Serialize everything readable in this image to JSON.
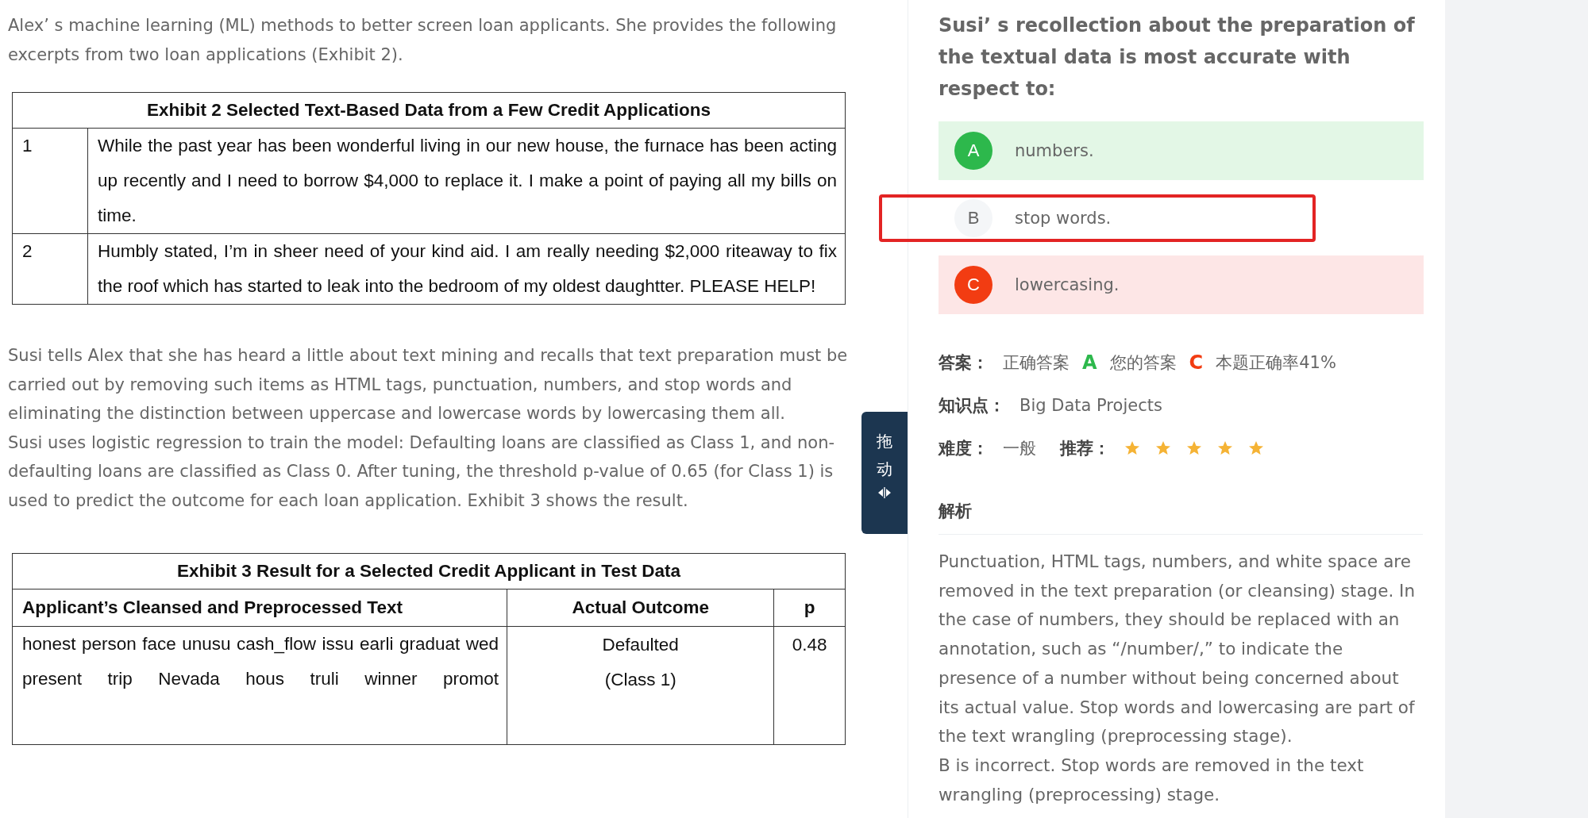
{
  "case": {
    "intro": "Alex’ s machine learning (ML) methods to better screen loan applicants. She provides the following excerpts from two loan applications (Exhibit 2).",
    "exhibit_2": {
      "title": "Exhibit 2 Selected Text-Based Data from a Few Credit Applications",
      "rows": [
        {
          "number": "1",
          "text": "While the past year has been wonderful living in our new house, the furnace has been acting up recently and I need to borrow $4,000 to replace it. I make a point of paying all my bills on time."
        },
        {
          "number": "2",
          "text": "Humbly stated, I’m in sheer need of your kind aid. I am really needing $2,000 riteaway to fix the roof which has started to leak into the bedroom of my oldest daughtter. PLEASE HELP!"
        }
      ]
    },
    "body": [
      "Susi tells Alex that she has heard a little about text mining and recalls that text preparation must be carried out by removing such items as HTML tags, punctuation, numbers, and stop words and eliminating the distinction between uppercase and lowercase words by lowercasing them all.",
      "Susi uses logistic regression to train the model: Defaulting loans are classified as Class 1, and non-defaulting loans are classified as Class 0. After tuning, the threshold p-value of 0.65 (for Class 1) is used to predict the outcome for each loan application. Exhibit 3 shows the result."
    ],
    "exhibit_3": {
      "title": "Exhibit 3 Result for a Selected Credit Applicant in Test Data",
      "columns": [
        "Applicant’s Cleansed and Preprocessed Text",
        "Actual Outcome",
        "p"
      ],
      "rows": [
        {
          "text": "honest person face unusu cash_flow issu earli graduat wed present trip Nevada hous truli winner promot",
          "outcome": [
            "Defaulted",
            "(Class 1)"
          ],
          "p": "0.48"
        }
      ]
    }
  },
  "drag_handle": {
    "label": "拖动"
  },
  "question": {
    "text": "Susi’ s recollection about the preparation of the textual data is most accurate with respect to:",
    "options": [
      {
        "letter": "A",
        "text": "numbers.",
        "kind": "correct",
        "highlighted": false
      },
      {
        "letter": "B",
        "text": "stop words.",
        "kind": "plain",
        "highlighted": true
      },
      {
        "letter": "C",
        "text": "lowercasing.",
        "kind": "wrong",
        "highlighted": false
      }
    ]
  },
  "answer": {
    "label": "答案：",
    "correct_label": "正确答案",
    "correct": "A",
    "yours_label": "您的答案",
    "yours": "C",
    "rate": "本题正确率41%"
  },
  "knowledge": {
    "label": "知识点：",
    "value": "Big Data Projects"
  },
  "difficulty": {
    "label": "难度：",
    "value": "一般"
  },
  "recommend": {
    "label": "推荐：",
    "stars": 5
  },
  "analysis": {
    "heading": "解析",
    "paragraphs": [
      "Punctuation, HTML tags, numbers, and white space are removed in the text preparation (or cleansing) stage. In the case of numbers, they should be replaced with an annotation, such as “/number/,” to indicate the presence of a number without being concerned about its actual value. Stop words and lowercasing are part of the text wrangling (preprocessing stage).",
      "B is incorrect. Stop words are removed in the text wrangling (preprocessing) stage."
    ]
  }
}
